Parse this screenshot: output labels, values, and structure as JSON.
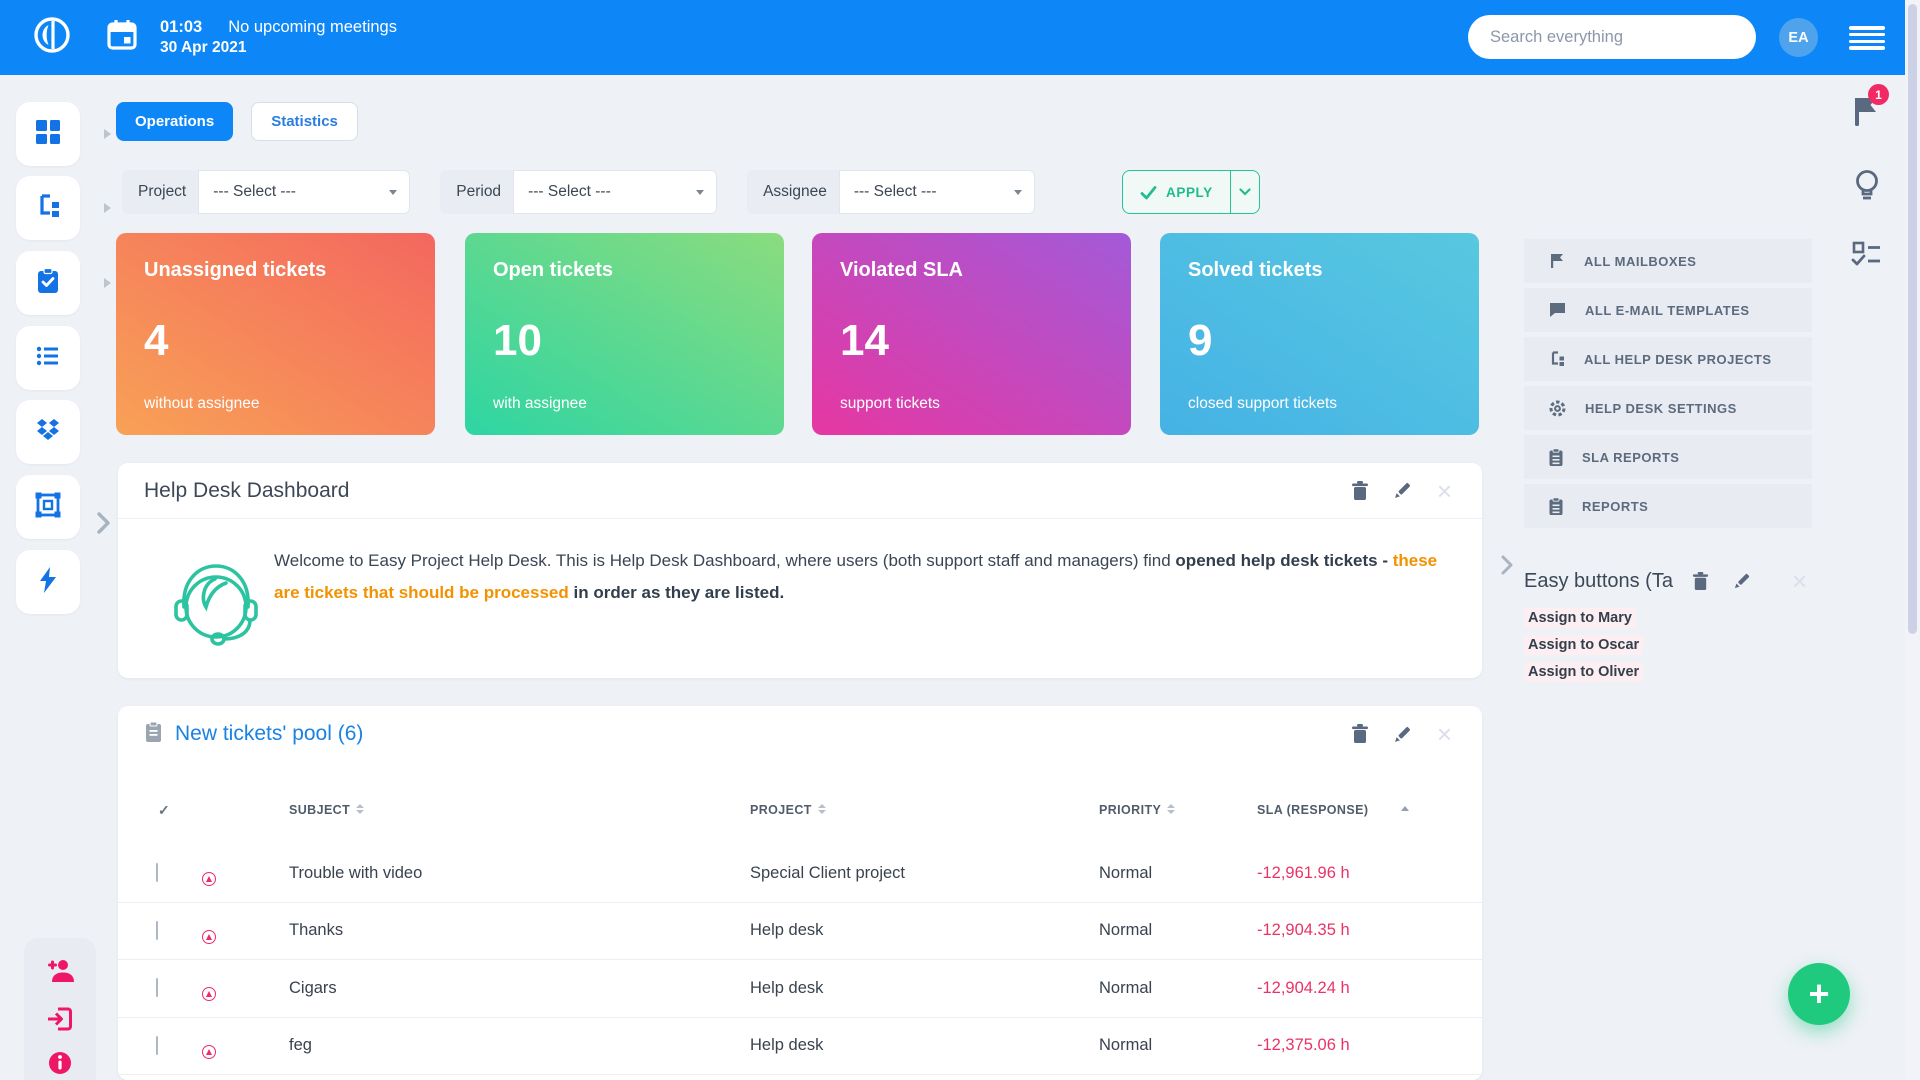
{
  "topbar": {
    "time": "01:03",
    "meeting_status": "No upcoming meetings",
    "date": "30 Apr 2021",
    "search_placeholder": "Search everything",
    "avatar_initials": "EA"
  },
  "notifications": {
    "flag_badge_count": "1"
  },
  "tabs": {
    "operations": "Operations",
    "statistics": "Statistics"
  },
  "filters": {
    "project_label": "Project",
    "period_label": "Period",
    "assignee_label": "Assignee",
    "select_placeholder": "--- Select ---",
    "apply_label": "APPLY"
  },
  "stat_cards": [
    {
      "title": "Unassigned tickets",
      "value": "4",
      "subtitle": "without assignee",
      "color_from": "#f8a156",
      "color_to": "#f4675f"
    },
    {
      "title": "Open tickets",
      "value": "10",
      "subtitle": "with assignee",
      "color_from": "#2ed5a3",
      "color_to": "#8bdc7e"
    },
    {
      "title": "Violated SLA",
      "value": "14",
      "subtitle": "support tickets",
      "color_from": "#e637a2",
      "color_to": "#a35ad8"
    },
    {
      "title": "Solved tickets",
      "value": "9",
      "subtitle": "closed support tickets",
      "color_from": "#45b2e5",
      "color_to": "#58c8e0"
    }
  ],
  "help_panel": {
    "title": "Help Desk Dashboard",
    "welcome_intro": "Welcome to Easy Project Help Desk. This is Help Desk Dashboard, where users (both support staff and managers) find ",
    "welcome_bold_1": "opened help desk tickets - ",
    "welcome_highlight": "these are tickets that should be processed",
    "welcome_bold_2": " in order as they are listed.",
    "highlight_color": "#f39200"
  },
  "tickets_panel": {
    "title": "New tickets' pool (6)",
    "select_all_mark": "✓",
    "columns": {
      "subject": "SUBJECT",
      "project": "PROJECT",
      "priority": "PRIORITY",
      "sla": "SLA (RESPONSE)"
    },
    "rows": [
      {
        "subject": "Trouble with video",
        "project": "Special Client project",
        "priority": "Normal",
        "sla": "-12,961.96 h"
      },
      {
        "subject": "Thanks",
        "project": "Help desk",
        "priority": "Normal",
        "sla": "-12,904.35 h"
      },
      {
        "subject": "Cigars",
        "project": "Help desk",
        "priority": "Normal",
        "sla": "-12,904.24 h"
      },
      {
        "subject": "feg",
        "project": "Help desk",
        "priority": "Normal",
        "sla": "-12,375.06 h"
      }
    ]
  },
  "right_menu": {
    "items": [
      {
        "label": "ALL MAILBOXES"
      },
      {
        "label": "ALL E-MAIL TEMPLATES"
      },
      {
        "label": "ALL HELP DESK PROJECTS"
      },
      {
        "label": "HELP DESK SETTINGS"
      },
      {
        "label": "SLA REPORTS"
      },
      {
        "label": "REPORTS"
      }
    ]
  },
  "easy_buttons": {
    "title": "Easy buttons (Ta",
    "links": [
      {
        "label": "Assign to Mary"
      },
      {
        "label": "Assign to Oscar"
      },
      {
        "label": "Assign to Oliver"
      }
    ]
  },
  "fab": {
    "label": "+"
  },
  "colors": {
    "topbar_blue": "#0d86f8",
    "accent_green": "#27c495",
    "fab_green": "#1fca7f",
    "sla_red": "#e93366",
    "link_blue": "#1a82e2",
    "highlight_orange": "#f39200",
    "pink_icon": "#ee2a68"
  }
}
